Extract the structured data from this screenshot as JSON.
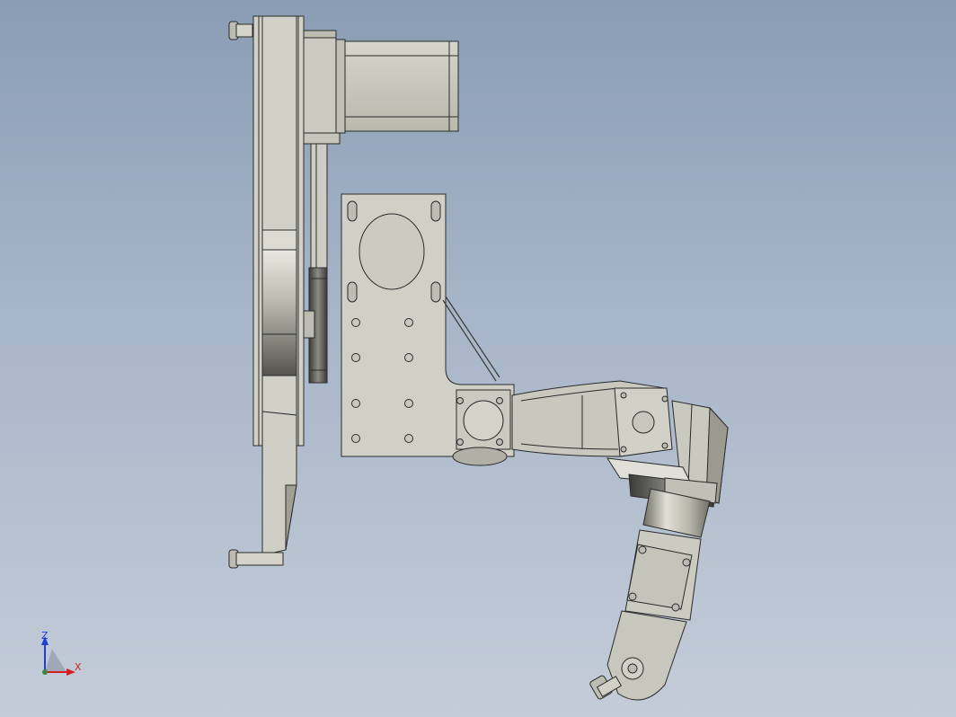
{
  "viewport": {
    "colors": {
      "bg_top": "#8a9db4",
      "bg_bottom": "#c4ccd8",
      "part_fill": "#cfcfc6",
      "part_edge": "#2b2b2b"
    }
  },
  "triad": {
    "z_label": "Z",
    "x_label": "X",
    "z_color": "#1f3fd6",
    "x_color": "#d42020"
  }
}
